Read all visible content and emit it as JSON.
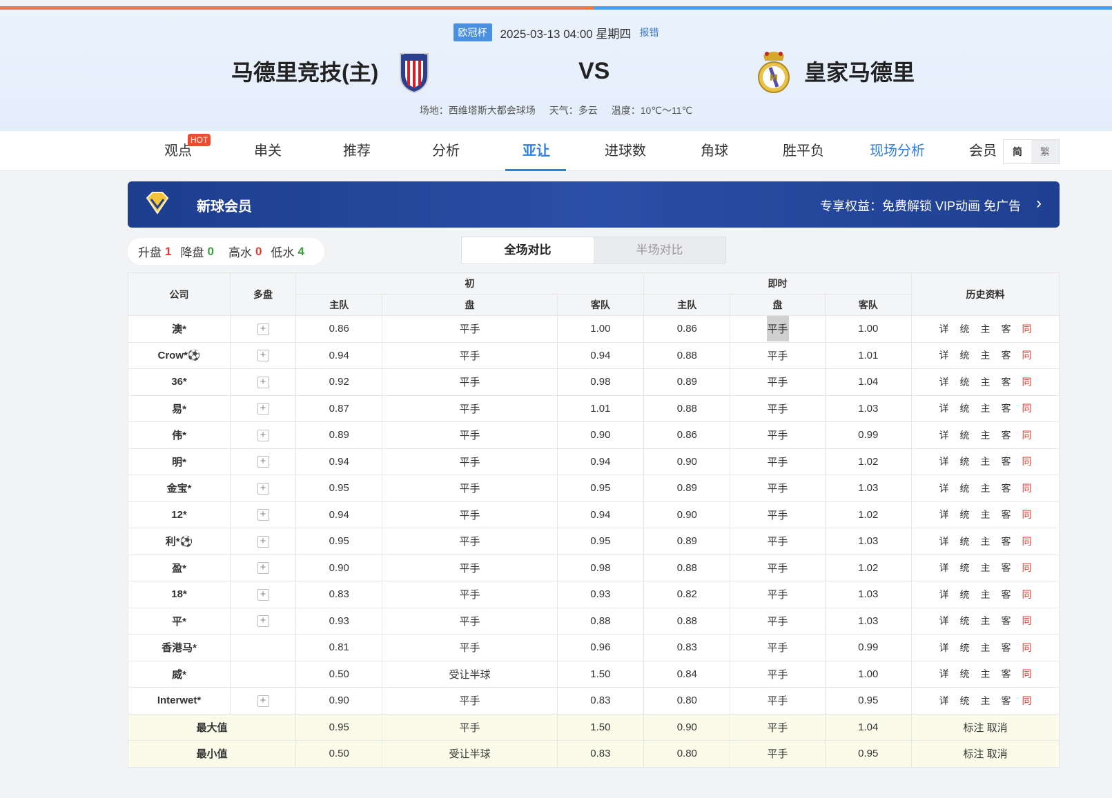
{
  "header": {
    "league": "欧冠杯",
    "datetime": "2025-03-13 04:00 星期四",
    "report": "报错",
    "home_team": "马德里竞技(主)",
    "vs": "VS",
    "away_team": "皇家马德里",
    "venue": "场地：西维塔斯大都会球场",
    "weather": "天气：多云",
    "temperature": "温度：10℃～11℃"
  },
  "nav": {
    "items": [
      "观点",
      "串关",
      "推荐",
      "分析",
      "亚让",
      "进球数",
      "角球",
      "胜平负",
      "现场分析",
      "会员"
    ],
    "active": "亚让",
    "hot_badge": "HOT",
    "lang_simplified": "简",
    "lang_traditional": "繁"
  },
  "vip": {
    "title": "新球会员",
    "desc": "专享权益：免费解锁 VIP动画 免广告",
    "arrow": "›"
  },
  "stats": {
    "up_label": "升盘",
    "up_value": "1",
    "down_label": "降盘",
    "down_value": "0",
    "high_label": "高水",
    "high_value": "0",
    "low_label": "低水",
    "low_value": "4"
  },
  "compare_tabs": {
    "full": "全场对比",
    "half": "半场对比"
  },
  "table": {
    "headers": {
      "company": "公司",
      "multi": "多盘",
      "initial": "初",
      "live": "即时",
      "history": "历史资料",
      "home": "主队",
      "line": "盘",
      "away": "客队"
    },
    "link_labels": [
      "详",
      "统",
      "主",
      "客",
      "同"
    ],
    "rows": [
      {
        "company": "澳*",
        "plus": true,
        "ih": "0.86",
        "il": "平手",
        "ia": "1.00",
        "lh": "0.86",
        "ll": "平手",
        "la": "1.00",
        "hl": true
      },
      {
        "company": "Crow*⚽",
        "plus": true,
        "ih": "0.94",
        "il": "平手",
        "ia": "0.94",
        "lh": "0.88",
        "ll": "平手",
        "la": "1.01"
      },
      {
        "company": "36*",
        "plus": true,
        "ih": "0.92",
        "il": "平手",
        "ia": "0.98",
        "lh": "0.89",
        "ll": "平手",
        "la": "1.04"
      },
      {
        "company": "易*",
        "plus": true,
        "ih": "0.87",
        "il": "平手",
        "ia": "1.01",
        "lh": "0.88",
        "ll": "平手",
        "la": "1.03"
      },
      {
        "company": "伟*",
        "plus": true,
        "ih": "0.89",
        "il": "平手",
        "ia": "0.90",
        "lh": "0.86",
        "ll": "平手",
        "la": "0.99"
      },
      {
        "company": "明*",
        "plus": true,
        "ih": "0.94",
        "il": "平手",
        "ia": "0.94",
        "lh": "0.90",
        "ll": "平手",
        "la": "1.02"
      },
      {
        "company": "金宝*",
        "plus": true,
        "ih": "0.95",
        "il": "平手",
        "ia": "0.95",
        "lh": "0.89",
        "ll": "平手",
        "la": "1.03"
      },
      {
        "company": "12*",
        "plus": true,
        "ih": "0.94",
        "il": "平手",
        "ia": "0.94",
        "lh": "0.90",
        "ll": "平手",
        "la": "1.02"
      },
      {
        "company": "利*⚽",
        "plus": true,
        "ih": "0.95",
        "il": "平手",
        "ia": "0.95",
        "lh": "0.89",
        "ll": "平手",
        "la": "1.03"
      },
      {
        "company": "盈*",
        "plus": true,
        "ih": "0.90",
        "il": "平手",
        "ia": "0.98",
        "lh": "0.88",
        "ll": "平手",
        "la": "1.02"
      },
      {
        "company": "18*",
        "plus": true,
        "ih": "0.83",
        "il": "平手",
        "ia": "0.93",
        "lh": "0.82",
        "ll": "平手",
        "la": "1.03"
      },
      {
        "company": "平*",
        "plus": true,
        "ih": "0.93",
        "il": "平手",
        "ia": "0.88",
        "lh": "0.88",
        "ll": "平手",
        "la": "1.03"
      },
      {
        "company": "香港马*",
        "plus": false,
        "ih": "0.81",
        "il": "平手",
        "ia": "0.96",
        "lh": "0.83",
        "ll": "平手",
        "la": "0.99"
      },
      {
        "company": "威*",
        "plus": false,
        "ih": "0.50",
        "il": "受让半球",
        "ia": "1.50",
        "lh": "0.84",
        "ll": "平手",
        "la": "1.00"
      },
      {
        "company": "Interwet*",
        "plus": true,
        "ih": "0.90",
        "il": "平手",
        "ia": "0.83",
        "lh": "0.80",
        "ll": "平手",
        "la": "0.95"
      }
    ],
    "summary": [
      {
        "label": "最大值",
        "ih": "0.95",
        "il": "平手",
        "ia": "1.50",
        "lh": "0.90",
        "ll": "平手",
        "la": "1.04",
        "action": "标注 取消"
      },
      {
        "label": "最小值",
        "ih": "0.50",
        "il": "受让半球",
        "ia": "0.83",
        "lh": "0.80",
        "ll": "平手",
        "la": "0.95",
        "action": "标注 取消"
      }
    ]
  }
}
